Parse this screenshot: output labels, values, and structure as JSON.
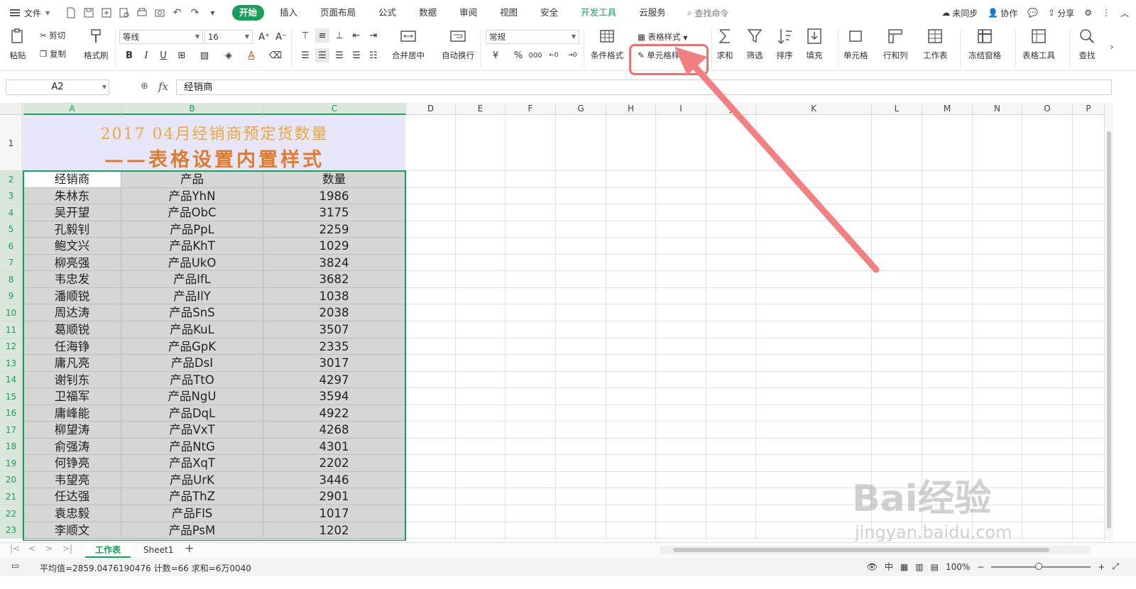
{
  "menubar": {
    "file": "文件",
    "tabs": [
      "开始",
      "插入",
      "页面布局",
      "公式",
      "数据",
      "审阅",
      "视图",
      "安全",
      "开发工具",
      "云服务"
    ],
    "search_placeholder": "查找命令",
    "right": {
      "sync": "未同步",
      "collab": "协作",
      "share": "分享"
    }
  },
  "ribbon": {
    "paste": "粘贴",
    "cut": "剪切",
    "copy": "复制",
    "format_painter": "格式刷",
    "font_name": "等线",
    "font_size": "16",
    "merge_center": "合并居中",
    "wrap_text": "自动换行",
    "number_format": "常规",
    "conditional_format": "条件格式",
    "table_style": "表格样式",
    "cell_style": "单元格样式",
    "sum": "求和",
    "filter": "筛选",
    "sort": "排序",
    "fill": "填充",
    "cell": "单元格",
    "row_col": "行和列",
    "worksheet": "工作表",
    "freeze": "冻结窗格",
    "table_tools": "表格工具",
    "find": "查找",
    "currency": "¥",
    "percent": "%",
    "thousands": "000"
  },
  "formula_bar": {
    "name_box": "A2",
    "fx": "fx",
    "value": "经销商"
  },
  "columns": [
    "A",
    "B",
    "C",
    "D",
    "E",
    "F",
    "G",
    "H",
    "I",
    "J",
    "K",
    "L",
    "M",
    "N",
    "O",
    "P"
  ],
  "title": {
    "line1": "2017 04月经销商预定货数量",
    "line2": "——表格设置内置样式"
  },
  "table": {
    "headers": [
      "经销商",
      "产品",
      "数量"
    ],
    "rows": [
      [
        "朱林东",
        "产品YhN",
        "1986"
      ],
      [
        "吴开望",
        "产品ObC",
        "3175"
      ],
      [
        "孔毅钊",
        "产品PpL",
        "2259"
      ],
      [
        "鲍文兴",
        "产品KhT",
        "1029"
      ],
      [
        "柳亮强",
        "产品UkO",
        "3824"
      ],
      [
        "韦忠发",
        "产品IfL",
        "3682"
      ],
      [
        "潘顺锐",
        "产品IlY",
        "1038"
      ],
      [
        "周达涛",
        "产品SnS",
        "2038"
      ],
      [
        "葛顺锐",
        "产品KuL",
        "3507"
      ],
      [
        "任海铮",
        "产品GpK",
        "2335"
      ],
      [
        "庸凡亮",
        "产品DsI",
        "3017"
      ],
      [
        "谢钊东",
        "产品TtO",
        "4297"
      ],
      [
        "卫福军",
        "产品NgU",
        "3594"
      ],
      [
        "庸峰能",
        "产品DqL",
        "4922"
      ],
      [
        "柳望涛",
        "产品VxT",
        "4268"
      ],
      [
        "俞强涛",
        "产品NtG",
        "4301"
      ],
      [
        "何铮亮",
        "产品XqT",
        "2202"
      ],
      [
        "韦望亮",
        "产品UrK",
        "3446"
      ],
      [
        "任达强",
        "产品ThZ",
        "2901"
      ],
      [
        "袁忠毅",
        "产品FlS",
        "1017"
      ],
      [
        "李顺文",
        "产品PsM",
        "1202"
      ]
    ]
  },
  "row_numbers": [
    "1",
    "2",
    "3",
    "4",
    "5",
    "6",
    "7",
    "8",
    "9",
    "10",
    "11",
    "12",
    "13",
    "14",
    "15",
    "16",
    "17",
    "18",
    "19",
    "20",
    "21",
    "22",
    "23"
  ],
  "sheets": [
    "工作表",
    "Sheet1"
  ],
  "status": {
    "text": "平均值=2859.0476190476  计数=66  求和=6万0040",
    "zoom": "100%"
  },
  "watermark": {
    "brand": "Bai经验",
    "url": "jingyan.baidu.com"
  },
  "colors": {
    "accent": "#18a058",
    "highlight": "#f26d6d",
    "title_bg": "#e6e6f8",
    "table_bg": "#d6d6d6"
  }
}
